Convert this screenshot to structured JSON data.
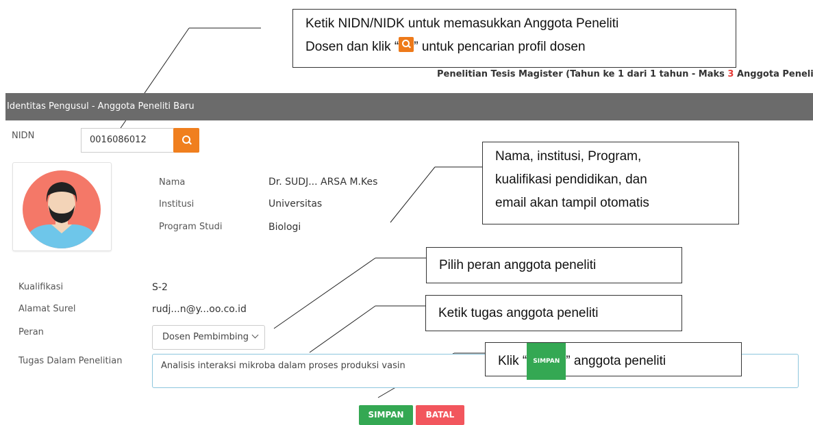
{
  "callouts": {
    "search_line1": "Ketik NIDN/NIDK untuk memasukkan Anggota Peneliti",
    "search_line2_pre": "Dosen dan klik “",
    "search_line2_post": "” untuk pencarian profil dosen",
    "auto_line1": "Nama, institusi, Program,",
    "auto_line2": "kualifikasi pendidikan, dan",
    "auto_line3": "email akan tampil otomatis",
    "peran": "Pilih peran anggota peneliti",
    "tugas": "Ketik tugas anggota peneliti",
    "simpan_pre": "Klik “",
    "simpan_chip": "SIMPAN",
    "simpan_post": "” anggota peneliti"
  },
  "scheme": {
    "prefix": "Penelitian Tesis Magister (Tahun ke 1 dari 1 tahun - Maks ",
    "max": "3",
    "suffix": " Anggota Peneliti)",
    "max_color": "#e53935"
  },
  "header": {
    "title": "Identitas Pengusul - Anggota Peneliti Baru"
  },
  "search": {
    "label": "NIDN",
    "value": "0016086012",
    "icon": "search-icon"
  },
  "profile": {
    "nama_label": "Nama",
    "nama_value": "Dr. SUDJ... ARSA M.Kes",
    "institusi_label": "Institusi",
    "institusi_value": "Universitas",
    "prodi_label": "Program Studi",
    "prodi_value": "Biologi",
    "kualifikasi_label": "Kualifikasi",
    "kualifikasi_value": "S-2",
    "email_label": "Alamat Surel",
    "email_value": "rudj...n@y...oo.co.id"
  },
  "form": {
    "peran_label": "Peran",
    "peran_value": "Dosen Pembimbing",
    "tugas_label": "Tugas Dalam Penelitian",
    "tugas_value": "Analisis interaksi mikroba dalam proses produksi vasin"
  },
  "buttons": {
    "simpan": "SIMPAN",
    "batal": "BATAL"
  },
  "colors": {
    "orange": "#f07f1e",
    "green": "#34a853",
    "red": "#f2565d",
    "header": "#6b6b6b"
  }
}
